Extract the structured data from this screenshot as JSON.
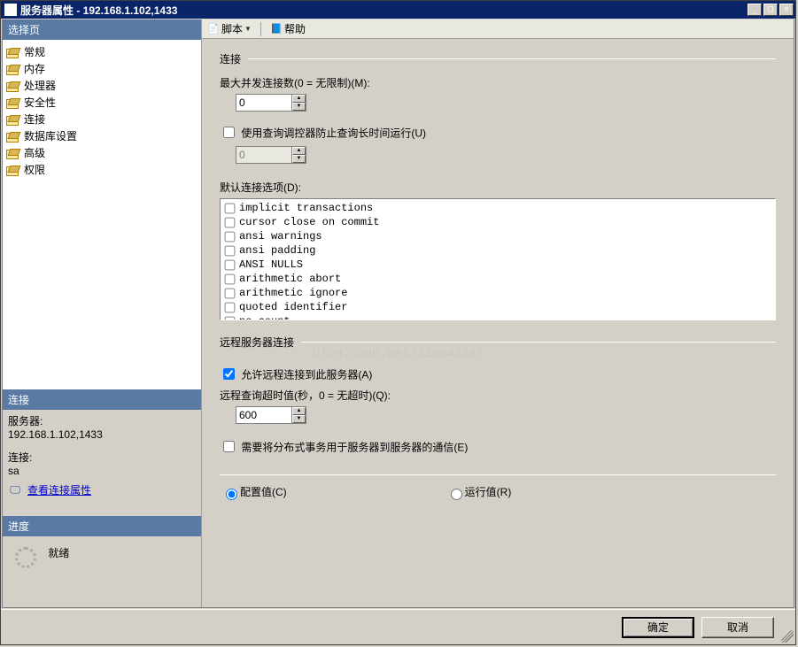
{
  "title": "服务器属性 - 192.168.1.102,1433",
  "sidebar": {
    "header": "选择页",
    "items": [
      {
        "label": "常规"
      },
      {
        "label": "内存"
      },
      {
        "label": "处理器"
      },
      {
        "label": "安全性"
      },
      {
        "label": "连接"
      },
      {
        "label": "数据库设置"
      },
      {
        "label": "高级"
      },
      {
        "label": "权限"
      }
    ],
    "conn_header": "连接",
    "server_lbl": "服务器:",
    "server_val": "192.168.1.102,1433",
    "conn_lbl": "连接:",
    "conn_val": "sa",
    "view_link": "查看连接属性",
    "progress_header": "进度",
    "progress_status": "就绪"
  },
  "toolbar": {
    "script": "脚本",
    "help": "帮助"
  },
  "form": {
    "group1": "连接",
    "max_conn_lbl": "最大并发连接数(0 = 无限制)(M):",
    "max_conn_val": "0",
    "use_governor": "使用查询调控器防止查询长时间运行(U)",
    "governor_val": "0",
    "default_opts_lbl": "默认连接选项(D):",
    "opts": [
      "implicit transactions",
      "cursor close on commit",
      "ansi warnings",
      "ansi padding",
      "ANSI NULLS",
      "arithmetic abort",
      "arithmetic ignore",
      "quoted identifier",
      "no count"
    ],
    "group2": "远程服务器连接",
    "allow_remote": "允许远程连接到此服务器(A)",
    "remote_timeout_lbl": "远程查询超时值(秒，0 = 无超时)(Q):",
    "remote_timeout_val": "600",
    "require_dist": "需要将分布式事务用于服务器到服务器的通信(E)",
    "radio_conf": "配置值(C)",
    "radio_run": "运行值(R)"
  },
  "buttons": {
    "ok": "确定",
    "cancel": "取消"
  },
  "watermark": "blog.csdn.net/z10843087"
}
